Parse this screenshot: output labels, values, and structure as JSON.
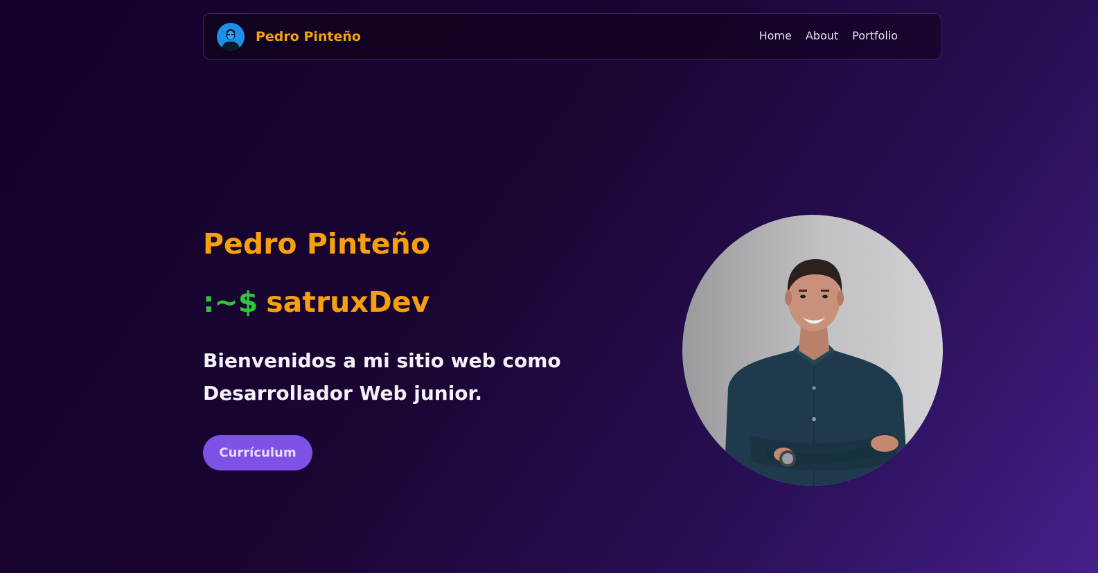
{
  "nav": {
    "brand_name": "Pedro Pinteño",
    "links": [
      {
        "label": "Home"
      },
      {
        "label": "About"
      },
      {
        "label": "Portfolio"
      }
    ]
  },
  "hero": {
    "name": "Pedro Pinteño",
    "prompt": ":~$",
    "handle": "satruxDev",
    "tagline_line1": "Bienvenidos a mi sitio web como",
    "tagline_line2": "Desarrollador Web junior.",
    "cv_button_label": "Currículum"
  },
  "colors": {
    "accent_orange": "#f6a010",
    "prompt_green": "#2fc63a",
    "button_purple": "#7e52e6",
    "background_dark": "#14022a",
    "background_light": "#45208a"
  },
  "icons": {
    "brand_avatar": "avatar-icon",
    "portrait": "profile-photo"
  }
}
